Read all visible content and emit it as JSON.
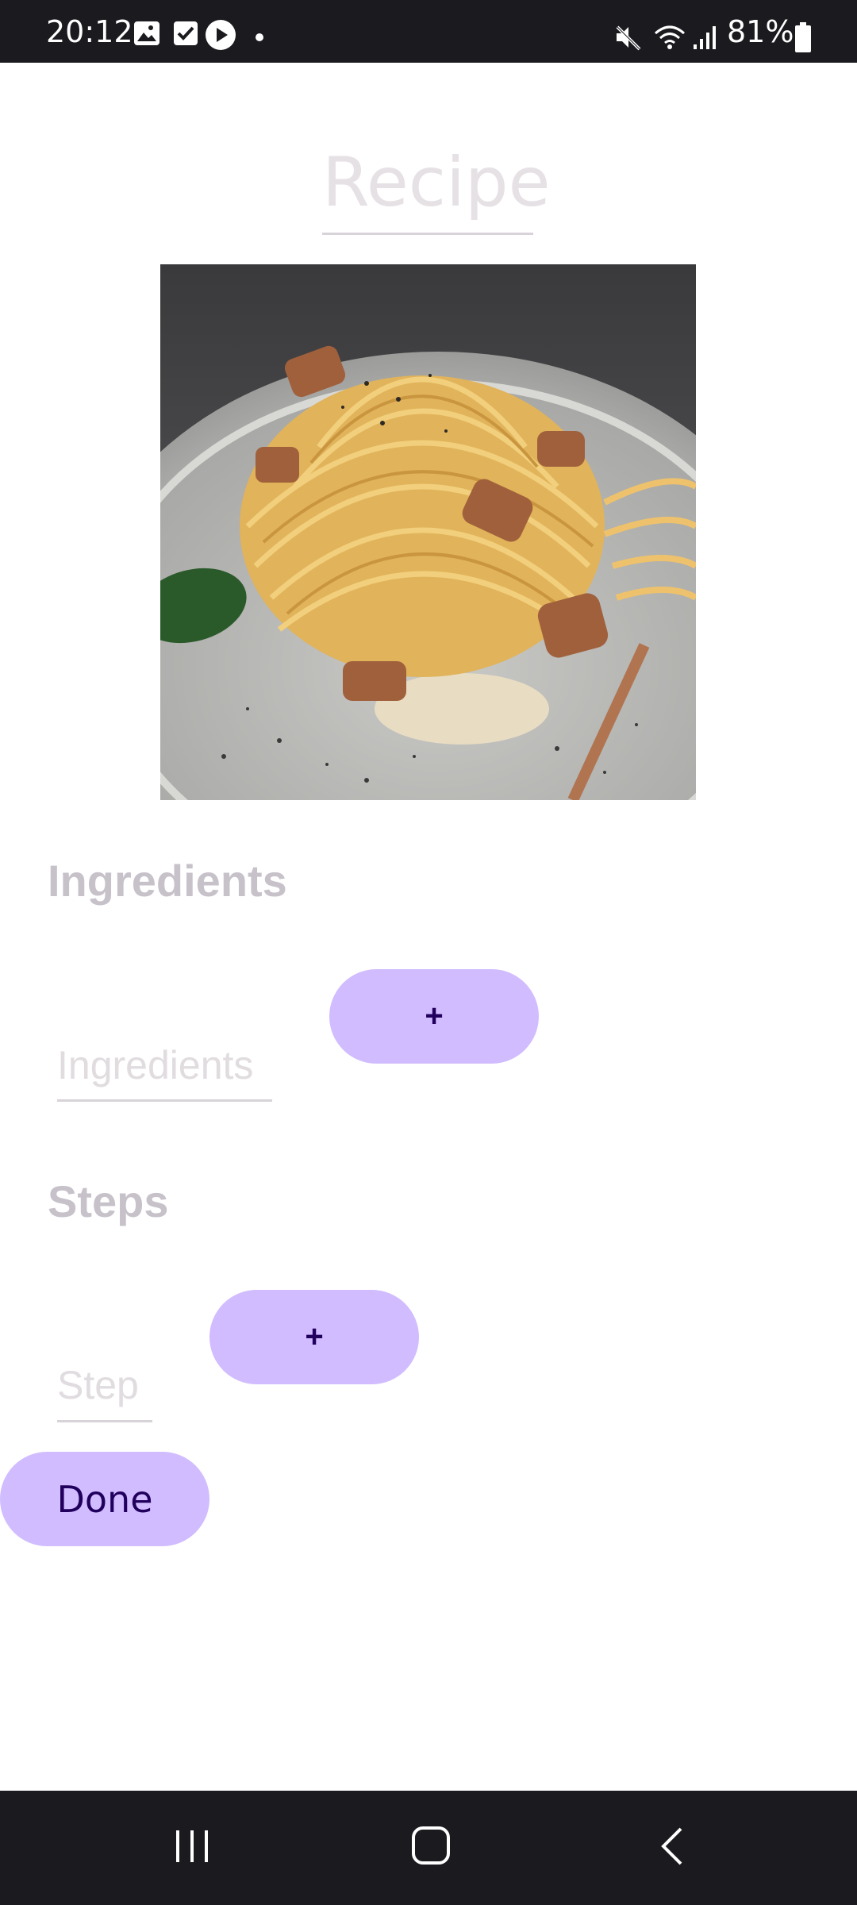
{
  "status_bar": {
    "time": "20:12",
    "battery_text": "81%",
    "icons": [
      "gallery-icon",
      "checkbox-icon",
      "play-icon",
      "notification-dot",
      "mute-icon",
      "wifi-icon",
      "signal-icon",
      "battery-icon"
    ]
  },
  "recipe": {
    "title": "Recipe",
    "image_description_icon": "pasta-photo"
  },
  "ingredients_section": {
    "heading": "Ingredients",
    "input_placeholder": "Ingredients",
    "add_button_label": "+"
  },
  "steps_section": {
    "heading": "Steps",
    "input_placeholder": "Step",
    "add_button_label": "+"
  },
  "done_button_label": "Done",
  "nav_bar": {
    "icons": [
      "recent-apps-icon",
      "home-icon",
      "back-icon"
    ]
  },
  "colors": {
    "button_bg": "#d0bcfe",
    "button_text": "#21005d",
    "bar_bg": "#1b1a1f"
  }
}
